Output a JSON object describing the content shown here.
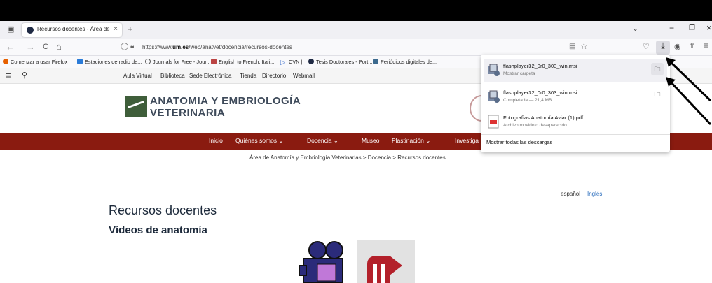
{
  "tab": {
    "title": "Recursos docentes - Área de An",
    "close": "×",
    "new": "+"
  },
  "window": {
    "chevron": "⌄",
    "minimize": "−",
    "restore": "❐",
    "close": "×"
  },
  "nav": {
    "back": "←",
    "forward": "→",
    "reload": "C",
    "home": "⌂",
    "url_prefix": "https://www.",
    "url_host": "um.es",
    "url_path": "/web/anatvet/docencia/recursos-docentes"
  },
  "bookmarks": [
    "Comenzar a usar Firefox",
    "Estaciones de radio de...",
    "Journals for Free - Jour...",
    "English to French, Itali...",
    "CVN |",
    "Tesis Doctorales - Port...",
    "Periódicos digitales de..."
  ],
  "site_top": [
    "Aula Virtual",
    "Biblioteca",
    "Sede Electrónica",
    "Tienda",
    "Directorio",
    "Webmail"
  ],
  "site_title": {
    "line1": "ANATOMIA Y EMBRIOLOGÍA",
    "line2": "VETERINARIA"
  },
  "main_nav": [
    "Inicio",
    "Quiénes somos ⌄",
    "Docencia ⌄",
    "Museo",
    "Plastinación ⌄",
    "Investiga"
  ],
  "breadcrumb": "Área de Anatomía y Embriología Veterinarias  >  Docencia  >  Recursos docentes",
  "lang": {
    "es": "español",
    "en": "Inglés"
  },
  "page": {
    "title": "Recursos docentes",
    "subtitle": "Vídeos de anatomía"
  },
  "downloads": {
    "items": [
      {
        "name": "flashplayer32_0r0_303_win.msi",
        "status": "Mostrar carpeta"
      },
      {
        "name": "flashplayer32_0r0_303_win.msi",
        "status": "Completada — 21,4 MB"
      },
      {
        "name": "Fotografías Anatomía Aviar (1).pdf",
        "status": "Archivo movido o desaparecido"
      }
    ],
    "show_all": "Mostrar todas las descargas"
  },
  "colors": {
    "brand_red": "#8a1b10",
    "logo_green": "#3f5e3a",
    "link_blue": "#2a6dbd"
  }
}
